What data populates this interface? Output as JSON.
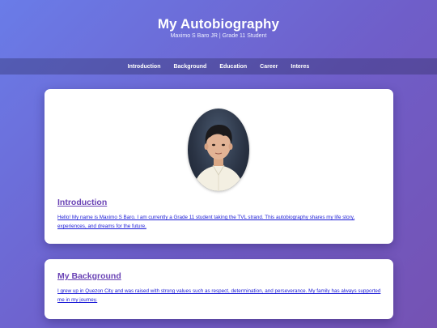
{
  "header": {
    "title": "My Autobiography",
    "subtitle": "Maximo S Baro JR | Grade 11 Student"
  },
  "nav": {
    "items": [
      "Introduction",
      "Background",
      "Education",
      "Career",
      "Interes"
    ]
  },
  "introduction": {
    "heading": "Introduction",
    "text": "Hello! My name is Maximo S Baro. I am currently a Grade 11 student taking the TVL strand. This autobiography shares my life story, experiences, and dreams for the future."
  },
  "background": {
    "heading": "My Background",
    "text": "I grew up in Quezon City and was raised with strong values such as respect, determination, and perseverance. My family has always supported me in my journey."
  }
}
